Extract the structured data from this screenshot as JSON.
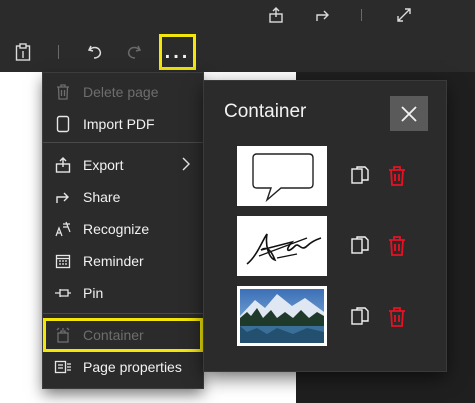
{
  "toolbar": {
    "top_icons": [
      "share-page-icon",
      "share-icon",
      "fullscreen-icon"
    ],
    "left_icons": [
      "clipboard-icon",
      "undo-icon",
      "redo-icon"
    ],
    "more_label": "..."
  },
  "menu": {
    "items": [
      {
        "label": "Delete page",
        "icon": "trash-icon",
        "disabled": true
      },
      {
        "label": "Import PDF",
        "icon": "document-icon",
        "disabled": false
      },
      {
        "label": "Export",
        "icon": "export-icon",
        "disabled": false,
        "submenu": true
      },
      {
        "label": "Share",
        "icon": "share-icon",
        "disabled": false
      },
      {
        "label": "Recognize",
        "icon": "recognize-icon",
        "disabled": false
      },
      {
        "label": "Reminder",
        "icon": "calendar-icon",
        "disabled": false
      },
      {
        "label": "Pin",
        "icon": "pin-icon",
        "disabled": false
      },
      {
        "label": "Container",
        "icon": "container-icon",
        "disabled": true
      },
      {
        "label": "Page properties",
        "icon": "page-properties-icon",
        "disabled": false
      }
    ]
  },
  "panel": {
    "title": "Container",
    "items": [
      {
        "thumbnail": "speech-bubble-drawing",
        "actions": [
          "copy-icon",
          "delete-icon"
        ]
      },
      {
        "thumbnail": "signature",
        "actions": [
          "copy-icon",
          "delete-icon"
        ]
      },
      {
        "thumbnail": "landscape-photo",
        "actions": [
          "copy-icon",
          "delete-icon"
        ]
      }
    ]
  },
  "colors": {
    "highlight": "#f2e60a",
    "delete": "#e81123",
    "background": "#2b2b2b"
  }
}
